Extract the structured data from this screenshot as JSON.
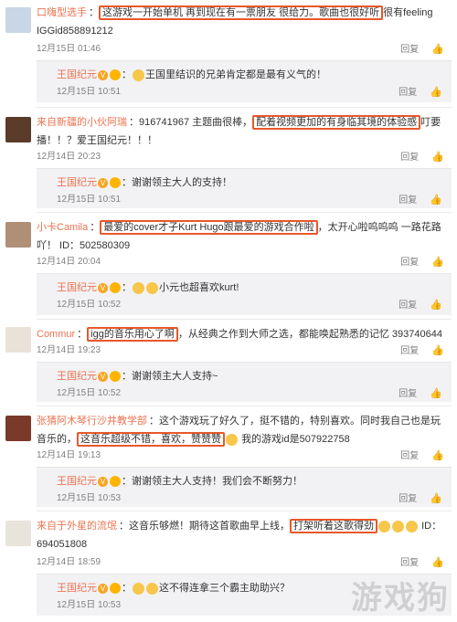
{
  "comments": [
    {
      "user": "口嗨型选手",
      "text_a": "",
      "highlight": "这游戏一开始单机 再到现在有一票朋友 很给力。歌曲也很好听",
      "text_b": "很有feeling  IGGid858891212",
      "date": "12月15日 01:46",
      "reply_label": "回复",
      "reply": {
        "user": "王国纪元",
        "text": "王国里结识的兄弟肯定都是最有义气的！",
        "date": "12月15日 10:51",
        "reply_label": "回复"
      }
    },
    {
      "user": "来自新疆的小伙阿瑞",
      "text_a": "：916741967 主题曲很棒，",
      "highlight": "配着视频更加的有身临其境的体验感",
      "text_b": "叮要播！！？爱王国纪元！！！",
      "date": "12月14日 20:23",
      "reply_label": "回复",
      "reply": {
        "user": "王国纪元",
        "text": "谢谢领主大人的支持！",
        "date": "12月15日 10:51",
        "reply_label": "回复"
      }
    },
    {
      "user": "小卡Camila",
      "text_a": "：",
      "highlight": "最爱的cover才子Kurt Hugo跟最爱的游戏合作啦",
      "text_b": "，太开心啦呜呜呜 一路花路吖！ ID：502580309",
      "date": "12月14日 20:04",
      "reply_label": "回复",
      "reply": {
        "user": "王国纪元",
        "text": "小元也超喜欢kurt!",
        "date": "12月15日 10:52",
        "reply_label": "回复"
      }
    },
    {
      "user": "Commur",
      "text_a": "：",
      "highlight": "igg的音乐用心了啊",
      "text_b": "，从经典之作到大师之选，都能唤起熟悉的记忆 393740644",
      "date": "12月14日 19:23",
      "reply_label": "回复",
      "reply": {
        "user": "王国纪元",
        "text": "谢谢领主大人支持~",
        "date": "12月15日 10:52",
        "reply_label": "回复"
      }
    },
    {
      "user": "张猜阿木琴行沙井教学部",
      "text_a": "：这个游戏玩了好久了，挺不错的，特别喜欢。同时我自己也是玩音乐的，",
      "highlight": "这音乐超级不错，喜欢，赞赞赞",
      "text_b": "我的游戏id是507922758",
      "date": "12月14日 19:13",
      "reply_label": "回复",
      "reply": {
        "user": "王国纪元",
        "text": "谢谢领主大人支持！我们会不断努力！",
        "date": "12月15日 10:53",
        "reply_label": "回复"
      }
    },
    {
      "user": "来自于外星的流氓",
      "text_a": "：这音乐够燃！期待这首歌曲早上线，",
      "highlight": "打架听着这歌得劲",
      "text_b": "ID：694051808",
      "date": "12月14日 18:59",
      "reply_label": "回复",
      "reply": {
        "user": "王国纪元",
        "text": "这不得连拿三个霸主助助兴？",
        "date": "12月15日 10:53",
        "reply_label": "回复"
      }
    }
  ],
  "watermark": "游戏狗",
  "colors": {
    "username": "#eb7350",
    "highlight_border": "#e8582a",
    "reply_bg": "#f2f2f5"
  }
}
